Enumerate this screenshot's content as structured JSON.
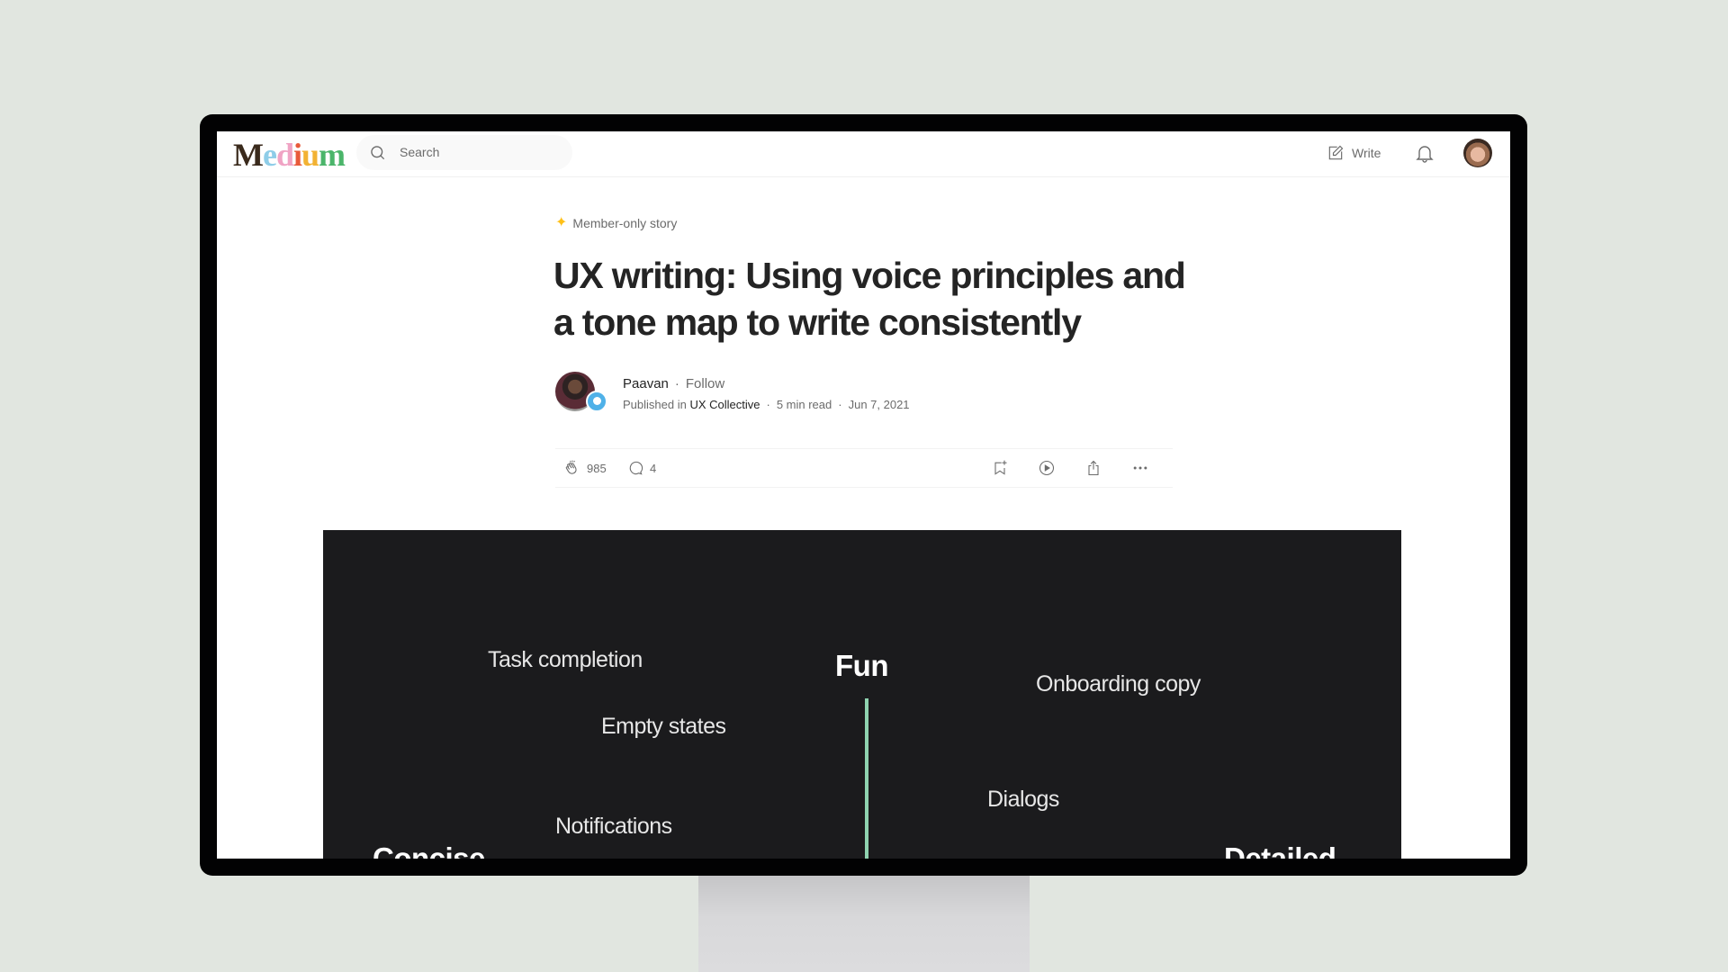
{
  "header": {
    "logo": "Medium",
    "search_placeholder": "Search",
    "write_label": "Write",
    "icons": [
      "search-icon",
      "write-icon",
      "bell-icon",
      "user-avatar"
    ]
  },
  "article": {
    "badge": "Member-only story",
    "badge_color": "#ffc017",
    "title": "UX writing: Using voice principles and a tone map to write consistently",
    "author": {
      "name": "Paavan",
      "follow_label": "Follow",
      "published_prefix": "Published in",
      "publication": "UX Collective",
      "read_time": "5 min read",
      "date": "Jun 7, 2021"
    },
    "actions": {
      "claps": "985",
      "responses": "4",
      "icons": [
        "clap-icon",
        "comment-icon",
        "bookmark-add-icon",
        "play-icon",
        "share-icon",
        "more-icon"
      ]
    }
  },
  "figure": {
    "background": "#1b1b1d",
    "accent_line_color": "#8fd3b0",
    "labels": {
      "task_completion": "Task completion",
      "fun": "Fun",
      "onboarding_copy": "Onboarding copy",
      "empty_states": "Empty states",
      "dialogs": "Dialogs",
      "notifications": "Notifications",
      "concise": "Concise",
      "detailed": "Detailed"
    }
  }
}
